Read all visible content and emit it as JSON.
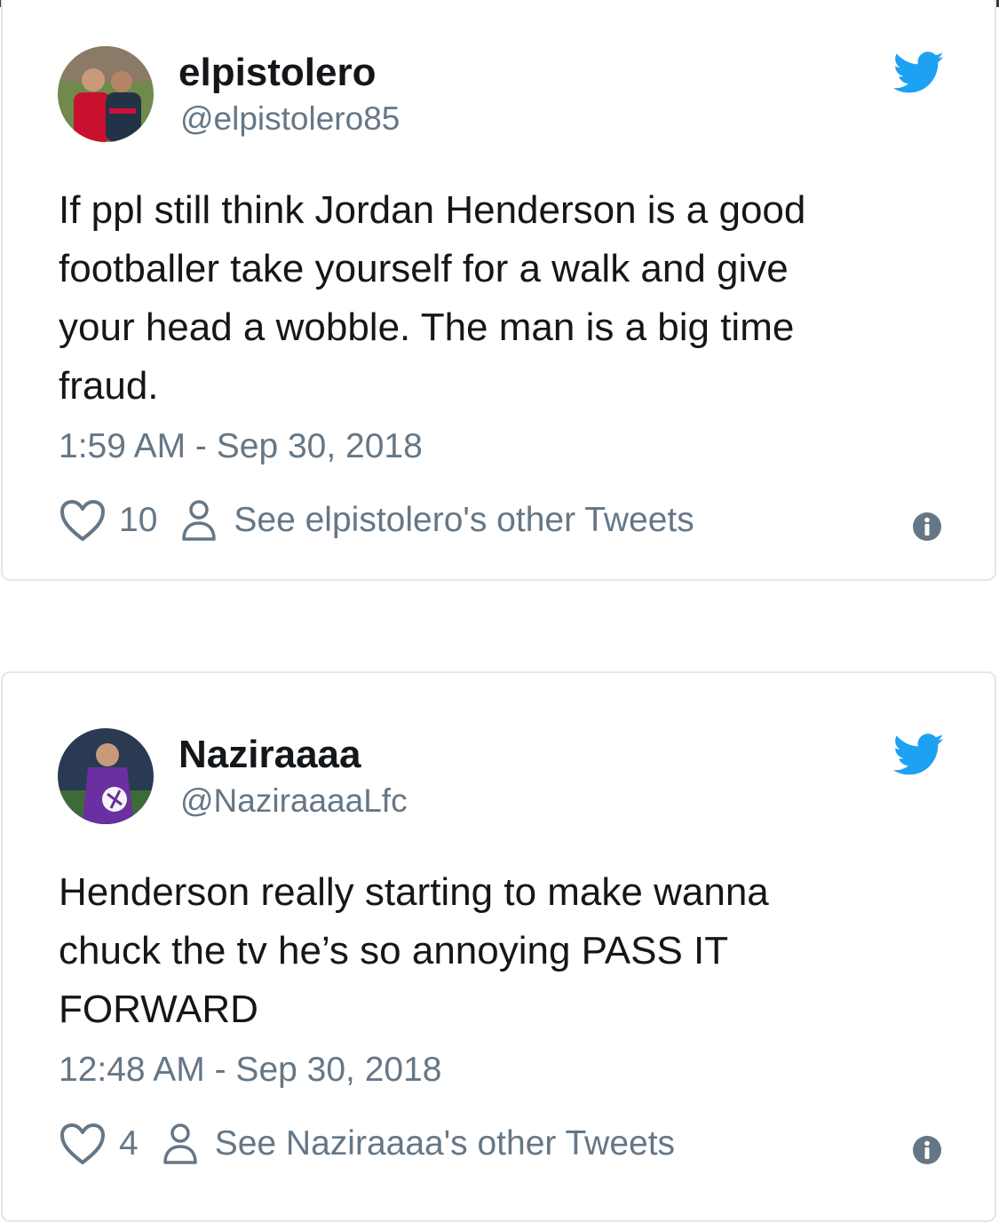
{
  "tweets": [
    {
      "display_name": "elpistolero",
      "handle": "@elpistolero85",
      "text": "If ppl still think Jordan Henderson is a good\nfootballer take yourself for a walk and give\nyour head a wobble. The man is a big time\nfraud.",
      "timestamp": "1:59 AM - Sep 30, 2018",
      "likes": "10",
      "other_tweets_label": "See elpistolero's other Tweets"
    },
    {
      "display_name": "Naziraaaa",
      "handle": "@NaziraaaaLfc",
      "text": "Henderson really starting to make wanna\nchuck the tv he’s so annoying PASS IT\nFORWARD",
      "timestamp": "12:48 AM - Sep 30, 2018",
      "likes": "4",
      "other_tweets_label": "See Naziraaaa's other Tweets"
    }
  ],
  "icons": {
    "brand": "twitter-bird-icon",
    "like": "heart-icon",
    "profile": "person-icon",
    "info": "info-icon"
  },
  "colors": {
    "twitter_blue": "#1da1f2",
    "secondary_text": "#657786",
    "border": "#e1e8ed"
  }
}
